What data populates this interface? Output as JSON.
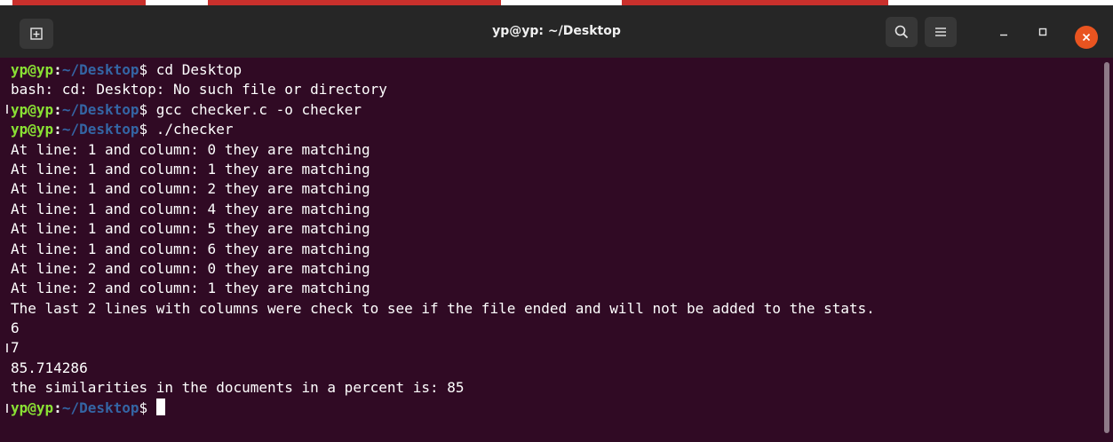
{
  "window": {
    "title": "yp@yp: ~/Desktop"
  },
  "icons": {
    "new_tab": "new-tab-icon",
    "search": "search-icon",
    "menu": "hamburger-menu-icon",
    "minimize": "minimize-icon",
    "maximize": "maximize-icon",
    "close": "close-icon"
  },
  "colors": {
    "terminal_bg": "#300a24",
    "titlebar_bg": "#262626",
    "prompt_user": "#8ae234",
    "prompt_path": "#3465a4",
    "close_button": "#e95420"
  },
  "prompt": {
    "user": "yp@yp",
    "colon": ":",
    "path": "~/Desktop",
    "symbol": "$"
  },
  "terminal": {
    "lines": [
      {
        "type": "prompt",
        "command": " cd Desktop"
      },
      {
        "type": "output",
        "text": "bash: cd: Desktop: No such file or directory"
      },
      {
        "type": "prompt",
        "command": " gcc checker.c -o checker"
      },
      {
        "type": "prompt",
        "command": " ./checker"
      },
      {
        "type": "output",
        "text": "At line: 1 and column: 0 they are matching"
      },
      {
        "type": "output",
        "text": "At line: 1 and column: 1 they are matching"
      },
      {
        "type": "output",
        "text": "At line: 1 and column: 2 they are matching"
      },
      {
        "type": "output",
        "text": "At line: 1 and column: 4 they are matching"
      },
      {
        "type": "output",
        "text": "At line: 1 and column: 5 they are matching"
      },
      {
        "type": "output",
        "text": "At line: 1 and column: 6 they are matching"
      },
      {
        "type": "output",
        "text": "At line: 2 and column: 0 they are matching"
      },
      {
        "type": "output",
        "text": "At line: 2 and column: 1 they are matching"
      },
      {
        "type": "output",
        "text": "The last 2 lines with columns were check to see if the file ended and will not be added to the stats."
      },
      {
        "type": "output",
        "text": "6"
      },
      {
        "type": "output",
        "text": "7"
      },
      {
        "type": "output",
        "text": "85.714286"
      },
      {
        "type": "output",
        "text": "the similarities in the documents in a percent is: 85"
      },
      {
        "type": "prompt",
        "command": " ",
        "cursor": true
      }
    ]
  }
}
